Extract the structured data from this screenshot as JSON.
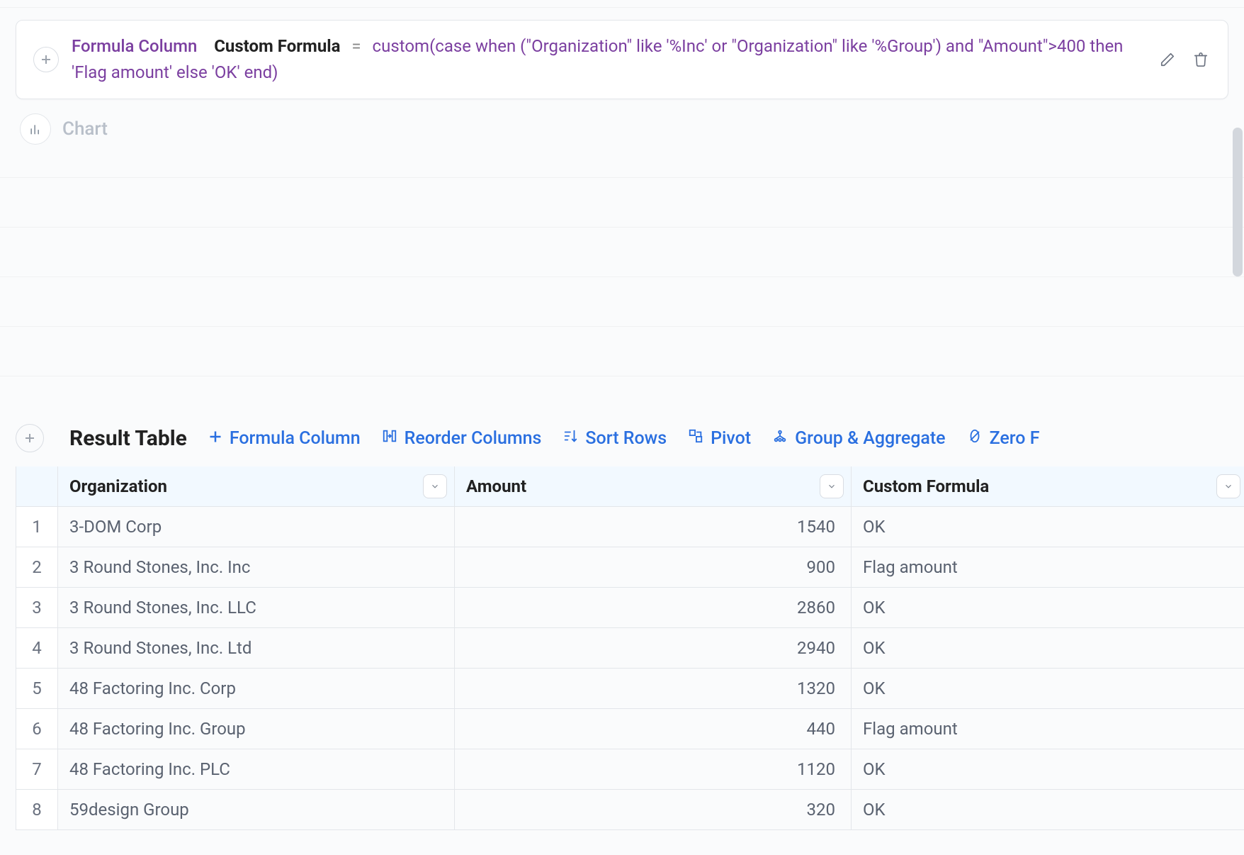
{
  "formula": {
    "label": "Formula Column",
    "name": "Custom Formula",
    "equals": "=",
    "expression": "custom(case when (\"Organization\" like '%Inc' or \"Organization\" like '%Group') and \"Amount\">400 then 'Flag amount' else 'OK' end)"
  },
  "chart": {
    "label": "Chart"
  },
  "result": {
    "title": "Result Table",
    "tools": {
      "formula_column": "Formula Column",
      "reorder_columns": "Reorder Columns",
      "sort_rows": "Sort Rows",
      "pivot": "Pivot",
      "group_aggregate": "Group & Aggregate",
      "zero_fill": "Zero F"
    },
    "columns": {
      "organization": "Organization",
      "amount": "Amount",
      "custom_formula": "Custom Formula"
    },
    "rows": [
      {
        "n": "1",
        "organization": "3-DOM Corp",
        "amount": "1540",
        "custom_formula": "OK"
      },
      {
        "n": "2",
        "organization": "3 Round Stones, Inc. Inc",
        "amount": "900",
        "custom_formula": "Flag amount"
      },
      {
        "n": "3",
        "organization": "3 Round Stones, Inc. LLC",
        "amount": "2860",
        "custom_formula": "OK"
      },
      {
        "n": "4",
        "organization": "3 Round Stones, Inc. Ltd",
        "amount": "2940",
        "custom_formula": "OK"
      },
      {
        "n": "5",
        "organization": "48 Factoring Inc. Corp",
        "amount": "1320",
        "custom_formula": "OK"
      },
      {
        "n": "6",
        "organization": "48 Factoring Inc. Group",
        "amount": "440",
        "custom_formula": "Flag amount"
      },
      {
        "n": "7",
        "organization": "48 Factoring Inc. PLC",
        "amount": "1120",
        "custom_formula": "OK"
      },
      {
        "n": "8",
        "organization": "59design Group",
        "amount": "320",
        "custom_formula": "OK"
      }
    ]
  }
}
